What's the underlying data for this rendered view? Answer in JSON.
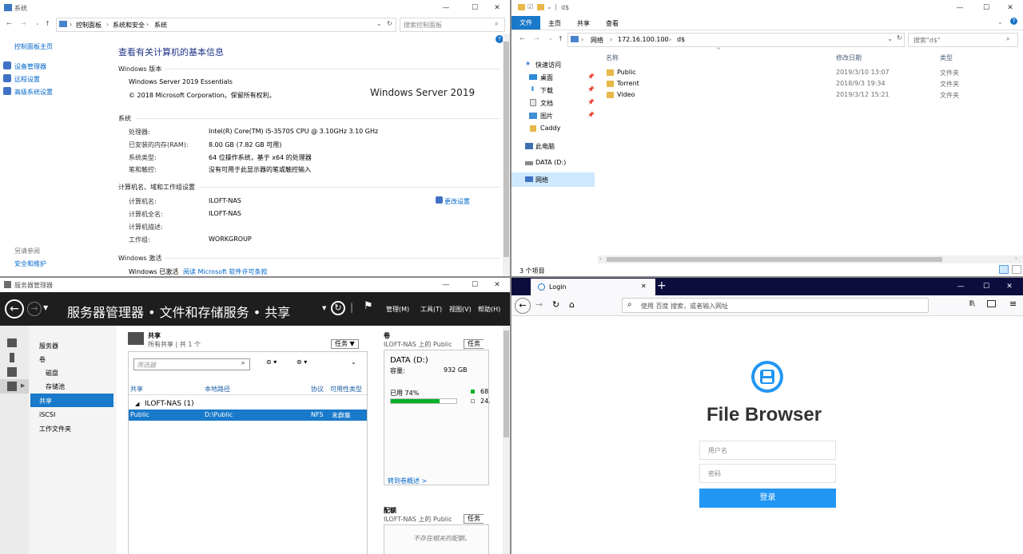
{
  "system": {
    "title": "系统",
    "breadcrumb": [
      "控制面板",
      "系统和安全",
      "系统"
    ],
    "search_placeholder": "搜索控制面板",
    "sidebar": {
      "home": "控制面板主页",
      "links": [
        "设备管理器",
        "远程设置",
        "高级系统设置"
      ],
      "see_also_header": "另请参阅",
      "see_also": "安全和维护"
    },
    "heading": "查看有关计算机的基本信息",
    "edition_header": "Windows 版本",
    "edition": "Windows Server 2019 Essentials",
    "copyright": "© 2018 Microsoft Corporation。保留所有权利。",
    "logo": "Windows Server 2019",
    "system_header": "系统",
    "rows": [
      {
        "label": "处理器:",
        "value": "Intel(R) Core(TM) i5-3570S CPU @ 3.10GHz   3.10 GHz"
      },
      {
        "label": "已安装的内存(RAM):",
        "value": "8.00 GB (7.82 GB 可用)"
      },
      {
        "label": "系统类型:",
        "value": "64 位操作系统，基于 x64 的处理器"
      },
      {
        "label": "笔和触控:",
        "value": "没有可用于此显示器的笔或触控输入"
      }
    ],
    "computer_header": "计算机名、域和工作组设置",
    "computer_rows": [
      {
        "label": "计算机名:",
        "value": "ILOFT-NAS"
      },
      {
        "label": "计算机全名:",
        "value": "ILOFT-NAS"
      },
      {
        "label": "计算机描述:",
        "value": ""
      },
      {
        "label": "工作组:",
        "value": "WORKGROUP"
      }
    ],
    "change_settings": "更改设置",
    "activation_header": "Windows 激活",
    "activated": "Windows 已激活",
    "license_link": "阅读 Microsoft 软件许可条款"
  },
  "explorer": {
    "title": "d$",
    "ribbon_tabs": [
      "文件",
      "主页",
      "共享",
      "查看"
    ],
    "path": [
      "网络",
      "172.16.100.100",
      "d$"
    ],
    "search_placeholder": "搜索\"d$\"",
    "nav": [
      {
        "label": "快速访问"
      },
      {
        "label": "桌面"
      },
      {
        "label": "下载"
      },
      {
        "label": "文档"
      },
      {
        "label": "图片"
      },
      {
        "label": "Caddy"
      },
      {
        "label": "此电脑"
      },
      {
        "label": "DATA (D:)"
      },
      {
        "label": "网络"
      }
    ],
    "columns": [
      "名称",
      "修改日期",
      "类型"
    ],
    "files": [
      {
        "name": "Public",
        "date": "2019/3/10 13:07",
        "type": "文件夹"
      },
      {
        "name": "Torrent",
        "date": "2018/9/3 19:34",
        "type": "文件夹"
      },
      {
        "name": "Video",
        "date": "2019/3/12 15:21",
        "type": "文件夹"
      }
    ],
    "status": "3 个项目"
  },
  "server_manager": {
    "title": "服务器管理器",
    "breadcrumb": "服务器管理器 • 文件和存储服务 • 共享",
    "menus": [
      "管理(M)",
      "工具(T)",
      "视图(V)",
      "帮助(H)"
    ],
    "nav": [
      "服务器",
      "卷",
      "磁盘",
      "存储池",
      "共享",
      "iSCSI",
      "工作文件夹"
    ],
    "shares": {
      "title": "共享",
      "subtitle": "所有共享 | 共 1 个",
      "tasks": "任务",
      "filter_placeholder": "筛选器",
      "columns": [
        "共享",
        "本地路径",
        "协议",
        "可用性类型"
      ],
      "group": "ILOFT-NAS (1)",
      "row": {
        "share": "Public",
        "path": "D:\\Public",
        "protocol": "NFS",
        "avail": "未群集"
      }
    },
    "volume": {
      "title": "卷",
      "subtitle": "ILOFT-NAS 上的 Public",
      "tasks": "任务",
      "drive": "DATA (D:)",
      "capacity_label": "容量:",
      "capacity": "932 GB",
      "used_label": "已用 74%",
      "used_fraction": 0.74,
      "legend_used": "68",
      "legend_free": "24.",
      "link": "转到卷概述 >"
    },
    "quota": {
      "title": "配额",
      "subtitle": "ILOFT-NAS 上的 Public",
      "tasks": "任务",
      "empty": "不存在相关的配额。"
    }
  },
  "firefox": {
    "tab_title": "Login",
    "url_placeholder": "使用 百度 搜索，或者输入网址",
    "app_title": "File Browser",
    "username_placeholder": "用户名",
    "password_placeholder": "密码",
    "login_button": "登录",
    "accent": "#2196f3"
  }
}
